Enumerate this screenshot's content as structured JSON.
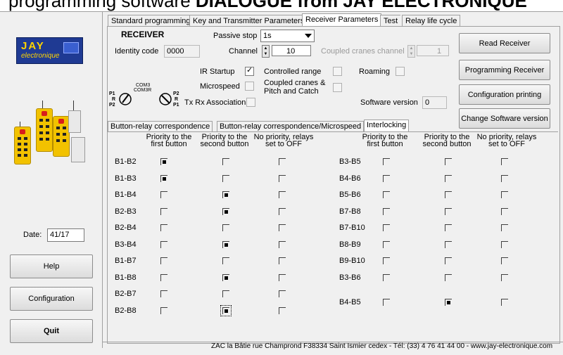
{
  "heading": {
    "pre": "programming software ",
    "bold": "DIALOGUE from JAY ELECTRONIQUE"
  },
  "logo": {
    "brand": "JAY",
    "sub": "electronique"
  },
  "left": {
    "date_label": "Date:",
    "date_value": "41/17",
    "help": "Help",
    "configuration": "Configuration",
    "quit": "Quit"
  },
  "tabs": [
    {
      "label": "Standard programming"
    },
    {
      "label": "Key and Transmitter Parameters"
    },
    {
      "label": "Receiver Parameters"
    },
    {
      "label": "Test"
    },
    {
      "label": "Relay life cycle"
    }
  ],
  "receiver": {
    "title": "RECEIVER",
    "passive_stop_label": "Passive stop",
    "passive_stop_value": "1s",
    "identity_label": "Identity code",
    "identity_value": "0000",
    "channel_label": "Channel",
    "channel_value": "10",
    "coupled_channel_label": "Coupled cranes channel",
    "coupled_channel_value": "1",
    "ir_startup": "IR Startup",
    "controlled_range": "Controlled range",
    "roaming": "Roaming",
    "microspeed": "Microspeed",
    "coupled_cranes": "Coupled cranes &",
    "pitch_catch": "Pitch and Catch",
    "txrx": "Tx Rx Association",
    "software_label": "Software version",
    "software_value": "0",
    "diagram": {
      "com3": "COM3",
      "com3r": "COM3R",
      "p1": "P1",
      "r": "R",
      "p2": "P2",
      "p2r": "P2",
      "rr": "R",
      "p1r": "P1"
    }
  },
  "actions": {
    "read": "Read Receiver",
    "program": "Programming Receiver",
    "config_print": "Configuration printing",
    "change_sw": "Change Software version"
  },
  "subtabs": [
    {
      "label": "Button-relay correspondence"
    },
    {
      "label": "Button-relay correspondence/Microspeed"
    },
    {
      "label": "Interlocking"
    }
  ],
  "interlock": {
    "headers": {
      "c1": [
        "Priority to the",
        "first button"
      ],
      "c2": [
        "Priority to the",
        "second button"
      ],
      "c3": [
        "No priority, relays",
        "set to OFF"
      ]
    },
    "left_rows": [
      {
        "pair": "B1-B2",
        "state": [
          1,
          0,
          0
        ]
      },
      {
        "pair": "B1-B3",
        "state": [
          1,
          0,
          0
        ]
      },
      {
        "pair": "B1-B4",
        "state": [
          0,
          1,
          0
        ]
      },
      {
        "pair": "B2-B3",
        "state": [
          0,
          1,
          0
        ]
      },
      {
        "pair": "B2-B4",
        "state": [
          0,
          0,
          0
        ]
      },
      {
        "pair": "B3-B4",
        "state": [
          0,
          1,
          0
        ]
      },
      {
        "pair": "B1-B7",
        "state": [
          0,
          0,
          0
        ]
      },
      {
        "pair": "B1-B8",
        "state": [
          0,
          1,
          0
        ]
      },
      {
        "pair": "B2-B7",
        "state": [
          0,
          0,
          0
        ]
      },
      {
        "pair": "B2-B8",
        "state": [
          0,
          1,
          0
        ]
      }
    ],
    "right_rows": [
      {
        "pair": "B3-B5",
        "state": [
          0,
          0,
          0
        ]
      },
      {
        "pair": "B4-B6",
        "state": [
          0,
          0,
          0
        ]
      },
      {
        "pair": "B5-B6",
        "state": [
          0,
          0,
          0
        ]
      },
      {
        "pair": "B7-B8",
        "state": [
          0,
          0,
          0
        ]
      },
      {
        "pair": "B7-B10",
        "state": [
          0,
          0,
          0
        ]
      },
      {
        "pair": "B8-B9",
        "state": [
          0,
          0,
          0
        ]
      },
      {
        "pair": "B9-B10",
        "state": [
          0,
          0,
          0
        ]
      },
      {
        "pair": "B3-B6",
        "state": [
          0,
          0,
          0
        ]
      },
      {
        "pair": "B4-B5",
        "state": [
          0,
          1,
          0
        ]
      }
    ]
  },
  "footer": "ZAC la Bâtie rue Champrond  F38334 Saint Ismier cedex - Tél: (33) 4 76 41 44 00 - www.jay-electronique.com"
}
